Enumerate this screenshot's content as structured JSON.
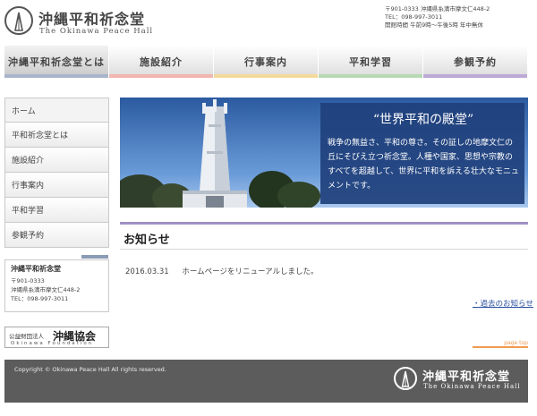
{
  "header": {
    "logo_title": "沖縄平和祈念堂",
    "logo_sub": "The Okinawa Peace Hall",
    "contact": [
      "〒901-0333 沖縄県糸満市摩文仁448-2",
      "TEL：098-997-3011",
      "開館時間 午前9時〜午後5時 年中無休"
    ]
  },
  "gnav": [
    {
      "label": "沖縄平和祈念堂とは",
      "color": "#a7b4c9"
    },
    {
      "label": "施設紹介",
      "color": "#f2b6b0"
    },
    {
      "label": "行事案内",
      "color": "#f3d99a"
    },
    {
      "label": "平和学習",
      "color": "#b7d9b1"
    },
    {
      "label": "参観予約",
      "color": "#bca9d8"
    }
  ],
  "sidebar": {
    "items": [
      "ホーム",
      "平和祈念堂とは",
      "施設紹介",
      "行事案内",
      "平和学習",
      "参観予約"
    ],
    "address": {
      "name": "沖縄平和祈念堂",
      "lines": [
        "〒901-0333",
        "沖縄県糸満市摩文仁448-2",
        "TEL：098-997-3011"
      ]
    },
    "foundation": {
      "prefix": "公益財団法人",
      "name": "沖縄協会",
      "roman": "Okinawa Foundation"
    }
  },
  "hero": {
    "title": "“世界平和の殿堂”",
    "text": "戦争の無益さ、平和の尊さ。その証しの地摩文仁の丘にそびえ立つ祈念堂。人種や国家、思想や宗教のすべてを超越して、世界に平和を訴える壮大なモニュメントです。"
  },
  "news": {
    "heading": "お知らせ",
    "items": [
      {
        "date": "2016.03.31",
        "text": "ホームページをリニューアルしました。"
      }
    ],
    "more": "過去のお知らせ",
    "pagetop": "page top"
  },
  "footer": {
    "copyright": "Copyright © Okinawa Peace Hall All rights reserved.",
    "logo_title": "沖縄平和祈念堂",
    "logo_sub": "The Okinawa Peace Hall"
  }
}
